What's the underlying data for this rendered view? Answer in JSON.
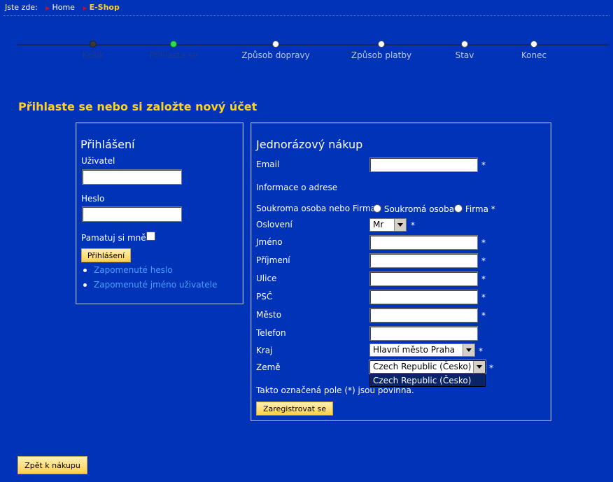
{
  "breadcrumb": {
    "prefix": "Jste zde:",
    "home": "Home",
    "current": "E-Shop"
  },
  "steps": [
    {
      "label": "Košík",
      "state": "done"
    },
    {
      "label": "Přihlaste se",
      "state": "active"
    },
    {
      "label": "Způsob dopravy",
      "state": "todo"
    },
    {
      "label": "Způsob platby",
      "state": "todo"
    },
    {
      "label": "Stav",
      "state": "todo"
    },
    {
      "label": "Konec",
      "state": "todo"
    }
  ],
  "page_title": "Přihlaste se nebo si založte nový účet",
  "login": {
    "title": "Přihlášení",
    "user_label": "Uživatel",
    "user_value": "",
    "password_label": "Heslo",
    "password_value": "",
    "remember_label": "Pamatuj si mně",
    "submit_label": "Přihlášení",
    "forgot_password": "Zapomenuté heslo",
    "forgot_username": "Zapomenuté jméno uživatele"
  },
  "guest": {
    "title": "Jednorázový nákup",
    "email_label": "Email",
    "address_info": "Informace o adrese",
    "type_label": "Soukroma osoba nebo Firma",
    "type_private": "Soukromá osoba",
    "type_company": "Firma",
    "salutation_label": "Oslovení",
    "salutation_value": "Mr",
    "first_name_label": "Jméno",
    "last_name_label": "Příjmení",
    "street_label": "Ulice",
    "zip_label": "PSČ",
    "city_label": "Město",
    "phone_label": "Telefon",
    "region_label": "Kraj",
    "region_value": "Hlavní město Praha",
    "country_label": "Země",
    "country_value": "Czech Republic (Česko)",
    "country_dropdown_option": "Czech Republic (Česko)",
    "required_note": "Takto označená pole (*) jsou povinna.",
    "register_label": "Zaregistrovat se",
    "required_mark": "*"
  },
  "back_label": "Zpět k nákupu",
  "colors": {
    "background": "#0033b8",
    "accent": "#ffd21f",
    "link": "#4aa0ff",
    "active_step": "#2de04a"
  }
}
